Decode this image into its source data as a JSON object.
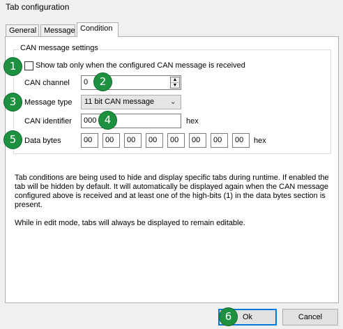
{
  "window": {
    "title": "Tab configuration"
  },
  "tabs": [
    {
      "label": "General"
    },
    {
      "label": "Message"
    },
    {
      "label": "Condition",
      "active": true
    }
  ],
  "group": {
    "label": "CAN message settings",
    "checkbox_label": "Show tab only when the configured CAN message is received",
    "checkbox_checked": false,
    "can_channel_label": "CAN channel",
    "can_channel_value": "0",
    "message_type_label": "Message type",
    "message_type_value": "11 bit CAN message",
    "can_identifier_label": "CAN identifier",
    "can_identifier_value": "000",
    "can_identifier_unit": "hex",
    "data_bytes_label": "Data bytes",
    "data_bytes": [
      "00",
      "00",
      "00",
      "00",
      "00",
      "00",
      "00",
      "00"
    ],
    "data_bytes_unit": "hex"
  },
  "description": {
    "p1": "Tab conditions are being used to hide and display specific tabs during runtime. If enabled the tab will be hidden by default. It will automatically be displayed again when the CAN message configured above is received and at least one of the high-bits (1) in the data bytes section is present.",
    "p2": "While in edit mode, tabs will always be displayed to remain editable."
  },
  "buttons": {
    "ok": "Ok",
    "cancel": "Cancel"
  },
  "markers": [
    "1",
    "2",
    "3",
    "4",
    "5",
    "6"
  ],
  "colors": {
    "marker": "#1e9141",
    "focus_border": "#0078d7"
  },
  "icons": {
    "spinner": "up-down-arrows",
    "dropdown": "chevron-down-icon"
  }
}
